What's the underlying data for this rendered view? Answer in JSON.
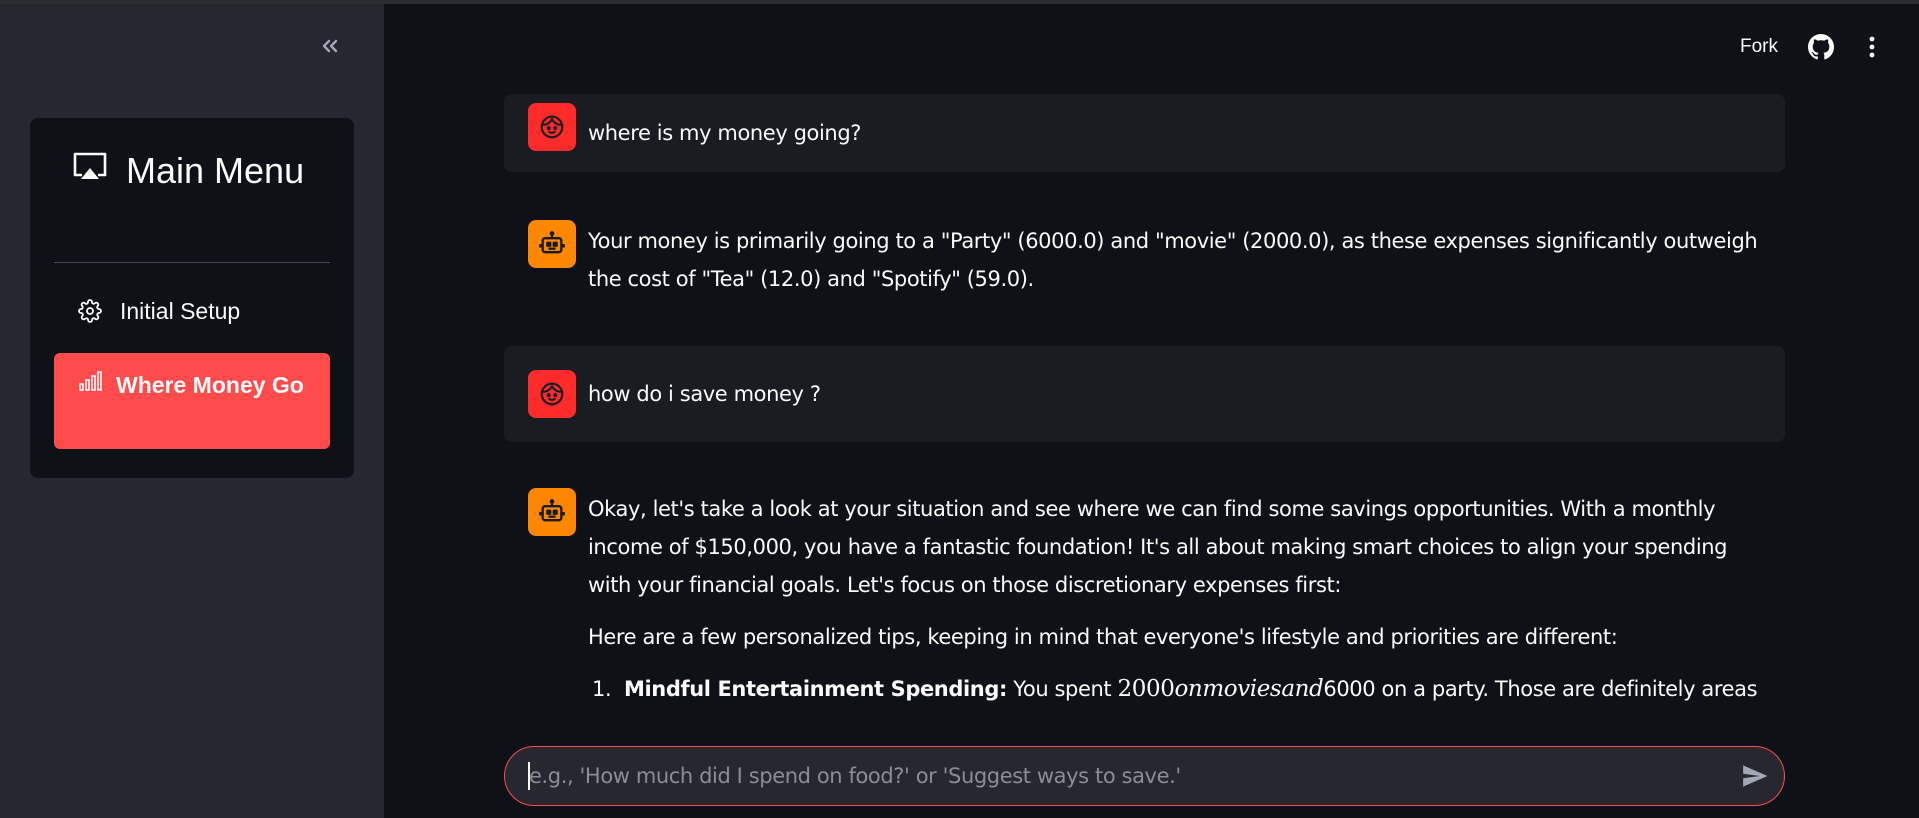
{
  "sidebar": {
    "collapse_icon": "chevrons-left-icon",
    "menu_title": "Main Menu",
    "menu_icon": "cast-screen-icon",
    "items": [
      {
        "label": "Initial Setup",
        "icon": "gear-icon",
        "active": false
      },
      {
        "label": "Where Money Go",
        "icon": "bar-chart-icon",
        "active": true
      }
    ],
    "active_color": "#ff4b4b"
  },
  "header": {
    "fork_label": "Fork",
    "github_icon": "github-icon",
    "menu_icon": "more-vertical-icon"
  },
  "chat": {
    "messages": [
      {
        "role": "user",
        "avatar_icon": "user-face-icon",
        "text": "where is my money going?"
      },
      {
        "role": "assistant",
        "avatar_icon": "robot-icon",
        "text": "Your money is primarily going to a \"Party\" (6000.0) and \"movie\" (2000.0), as these expenses significantly outweigh the cost of \"Tea\" (12.0) and \"Spotify\" (59.0)."
      },
      {
        "role": "user",
        "avatar_icon": "user-face-icon",
        "text": "how do i save money ?"
      },
      {
        "role": "assistant",
        "avatar_icon": "robot-icon",
        "paragraphs": [
          "Okay, let's take a look at your situation and see where we can find some savings opportunities. With a monthly income of $150,000, you have a fantastic foundation! It's all about making smart choices to align your spending with your financial goals. Let's focus on those discretionary expenses first:",
          "Here are a few personalized tips, keeping in mind that everyone's lifestyle and priorities are different:"
        ],
        "list": [
          {
            "num": "1.",
            "bold": "Mindful Entertainment Spending:",
            "pre": " You spent ",
            "math_num": "2000",
            "math_text": "onmoviesand",
            "post": "6000 on a party. Those are definitely areas"
          }
        ]
      }
    ]
  },
  "input": {
    "placeholder": "e.g., 'How much did I spend on food?' or 'Suggest ways to save.'",
    "value": "",
    "send_icon": "send-icon"
  },
  "colors": {
    "background": "#0e1117",
    "sidebar": "#262730",
    "user_bubble": "#1a1c24",
    "user_avatar": "#ff2b2b",
    "bot_avatar": "#ff8700",
    "accent": "#ff4b4b"
  }
}
